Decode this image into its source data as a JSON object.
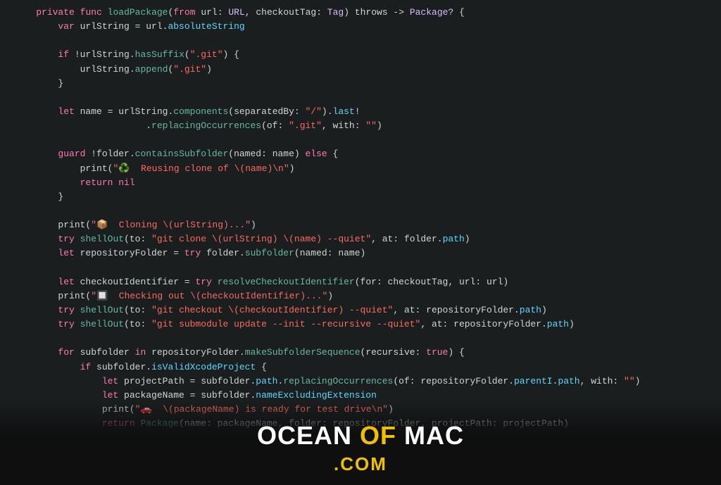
{
  "code": {
    "lines": [
      {
        "id": 1,
        "tokens": [
          {
            "t": "    ",
            "c": "plain"
          },
          {
            "t": "private",
            "c": "kw"
          },
          {
            "t": " ",
            "c": "plain"
          },
          {
            "t": "func",
            "c": "kw"
          },
          {
            "t": " ",
            "c": "plain"
          },
          {
            "t": "loadPackage",
            "c": "fn"
          },
          {
            "t": "(",
            "c": "plain"
          },
          {
            "t": "from",
            "c": "kw"
          },
          {
            "t": " url: ",
            "c": "plain"
          },
          {
            "t": "URL",
            "c": "type"
          },
          {
            "t": ", checkoutTag: ",
            "c": "plain"
          },
          {
            "t": "Tag",
            "c": "type"
          },
          {
            "t": ") throws -> ",
            "c": "plain"
          },
          {
            "t": "Package",
            "c": "type"
          },
          {
            "t": "? {",
            "c": "plain"
          }
        ]
      },
      {
        "id": 2,
        "tokens": [
          {
            "t": "        ",
            "c": "plain"
          },
          {
            "t": "var",
            "c": "kw"
          },
          {
            "t": " urlString = url.",
            "c": "plain"
          },
          {
            "t": "absoluteString",
            "c": "teal"
          }
        ]
      },
      {
        "id": 3,
        "tokens": []
      },
      {
        "id": 4,
        "tokens": [
          {
            "t": "        ",
            "c": "plain"
          },
          {
            "t": "if",
            "c": "kw"
          },
          {
            "t": " !urlString.",
            "c": "plain"
          },
          {
            "t": "hasSuffix",
            "c": "fn"
          },
          {
            "t": "(",
            "c": "plain"
          },
          {
            "t": "\".git\"",
            "c": "red"
          },
          {
            "t": ") {",
            "c": "plain"
          }
        ]
      },
      {
        "id": 5,
        "tokens": [
          {
            "t": "            urlString.",
            "c": "plain"
          },
          {
            "t": "append",
            "c": "fn"
          },
          {
            "t": "(",
            "c": "plain"
          },
          {
            "t": "\".git\"",
            "c": "red"
          },
          {
            "t": ")",
            "c": "plain"
          }
        ]
      },
      {
        "id": 6,
        "tokens": [
          {
            "t": "        }",
            "c": "plain"
          }
        ]
      },
      {
        "id": 7,
        "tokens": []
      },
      {
        "id": 8,
        "tokens": [
          {
            "t": "        ",
            "c": "plain"
          },
          {
            "t": "let",
            "c": "kw"
          },
          {
            "t": " name = urlString.",
            "c": "plain"
          },
          {
            "t": "components",
            "c": "fn"
          },
          {
            "t": "(separatedBy: ",
            "c": "plain"
          },
          {
            "t": "\"/\"",
            "c": "red"
          },
          {
            "t": ").",
            "c": "plain"
          },
          {
            "t": "last",
            "c": "teal"
          },
          {
            "t": "!",
            "c": "plain"
          }
        ]
      },
      {
        "id": 9,
        "tokens": [
          {
            "t": "                        .",
            "c": "plain"
          },
          {
            "t": "replacingOccurrences",
            "c": "fn"
          },
          {
            "t": "(of: ",
            "c": "plain"
          },
          {
            "t": "\".git\"",
            "c": "red"
          },
          {
            "t": ", with: ",
            "c": "plain"
          },
          {
            "t": "\"\"",
            "c": "red"
          },
          {
            "t": ")",
            "c": "plain"
          }
        ]
      },
      {
        "id": 10,
        "tokens": []
      },
      {
        "id": 11,
        "tokens": [
          {
            "t": "        ",
            "c": "plain"
          },
          {
            "t": "guard",
            "c": "kw"
          },
          {
            "t": " !folder.",
            "c": "plain"
          },
          {
            "t": "containsSubfolder",
            "c": "fn"
          },
          {
            "t": "(named: name) ",
            "c": "plain"
          },
          {
            "t": "else",
            "c": "kw"
          },
          {
            "t": " {",
            "c": "plain"
          }
        ]
      },
      {
        "id": 12,
        "tokens": [
          {
            "t": "            print(",
            "c": "plain"
          },
          {
            "t": "\"♻️  Reusing clone of \\(name)\\n\"",
            "c": "red"
          },
          {
            "t": ")",
            "c": "plain"
          }
        ]
      },
      {
        "id": 13,
        "tokens": [
          {
            "t": "            ",
            "c": "plain"
          },
          {
            "t": "return",
            "c": "kw"
          },
          {
            "t": " ",
            "c": "plain"
          },
          {
            "t": "nil",
            "c": "kw"
          }
        ]
      },
      {
        "id": 14,
        "tokens": [
          {
            "t": "        }",
            "c": "plain"
          }
        ]
      },
      {
        "id": 15,
        "tokens": []
      },
      {
        "id": 16,
        "tokens": [
          {
            "t": "        print(",
            "c": "plain"
          },
          {
            "t": "\"📦  Cloning \\(urlString)...\"",
            "c": "red"
          },
          {
            "t": ")",
            "c": "plain"
          }
        ]
      },
      {
        "id": 17,
        "tokens": [
          {
            "t": "        ",
            "c": "plain"
          },
          {
            "t": "try",
            "c": "kw"
          },
          {
            "t": " ",
            "c": "plain"
          },
          {
            "t": "shellOut",
            "c": "fn"
          },
          {
            "t": "(to: ",
            "c": "plain"
          },
          {
            "t": "\"git clone \\(urlString) \\(name) --quiet\"",
            "c": "red"
          },
          {
            "t": ", at: folder.",
            "c": "plain"
          },
          {
            "t": "path",
            "c": "teal"
          },
          {
            "t": ")",
            "c": "plain"
          }
        ]
      },
      {
        "id": 18,
        "tokens": [
          {
            "t": "        ",
            "c": "plain"
          },
          {
            "t": "let",
            "c": "kw"
          },
          {
            "t": " repositoryFolder = ",
            "c": "plain"
          },
          {
            "t": "try",
            "c": "kw"
          },
          {
            "t": " folder.",
            "c": "plain"
          },
          {
            "t": "subfolder",
            "c": "fn"
          },
          {
            "t": "(named: name)",
            "c": "plain"
          }
        ]
      },
      {
        "id": 19,
        "tokens": []
      },
      {
        "id": 20,
        "tokens": [
          {
            "t": "        ",
            "c": "plain"
          },
          {
            "t": "let",
            "c": "kw"
          },
          {
            "t": " checkoutIdentifier = ",
            "c": "plain"
          },
          {
            "t": "try",
            "c": "kw"
          },
          {
            "t": " ",
            "c": "plain"
          },
          {
            "t": "resolveCheckoutIdentifier",
            "c": "fn"
          },
          {
            "t": "(for: checkoutTag, url: url)",
            "c": "plain"
          }
        ]
      },
      {
        "id": 21,
        "tokens": [
          {
            "t": "        print(",
            "c": "plain"
          },
          {
            "t": "\"🔲  Checking out \\(checkoutIdentifier)...\"",
            "c": "red"
          },
          {
            "t": ")",
            "c": "plain"
          }
        ]
      },
      {
        "id": 22,
        "tokens": [
          {
            "t": "        ",
            "c": "plain"
          },
          {
            "t": "try",
            "c": "kw"
          },
          {
            "t": " ",
            "c": "plain"
          },
          {
            "t": "shellOut",
            "c": "fn"
          },
          {
            "t": "(to: ",
            "c": "plain"
          },
          {
            "t": "\"git checkout \\(checkoutIdentifier) --quiet\"",
            "c": "red"
          },
          {
            "t": ", at: repositoryFolder.",
            "c": "plain"
          },
          {
            "t": "path",
            "c": "teal"
          },
          {
            "t": ")",
            "c": "plain"
          }
        ]
      },
      {
        "id": 23,
        "tokens": [
          {
            "t": "        ",
            "c": "plain"
          },
          {
            "t": "try",
            "c": "kw"
          },
          {
            "t": " ",
            "c": "plain"
          },
          {
            "t": "shellOut",
            "c": "fn"
          },
          {
            "t": "(to: ",
            "c": "plain"
          },
          {
            "t": "\"git submodule update --init --recursive --quiet\"",
            "c": "red"
          },
          {
            "t": ", at: repositoryFolder.",
            "c": "plain"
          },
          {
            "t": "path",
            "c": "teal"
          },
          {
            "t": ")",
            "c": "plain"
          }
        ]
      },
      {
        "id": 24,
        "tokens": []
      },
      {
        "id": 25,
        "tokens": [
          {
            "t": "        ",
            "c": "plain"
          },
          {
            "t": "for",
            "c": "kw"
          },
          {
            "t": " subfolder ",
            "c": "plain"
          },
          {
            "t": "in",
            "c": "kw"
          },
          {
            "t": " repositoryFolder.",
            "c": "plain"
          },
          {
            "t": "makeSubfolderSequence",
            "c": "fn"
          },
          {
            "t": "(recursive: ",
            "c": "plain"
          },
          {
            "t": "true",
            "c": "kw"
          },
          {
            "t": ") {",
            "c": "plain"
          }
        ]
      },
      {
        "id": 26,
        "tokens": [
          {
            "t": "            ",
            "c": "plain"
          },
          {
            "t": "if",
            "c": "kw"
          },
          {
            "t": " subfolder.",
            "c": "plain"
          },
          {
            "t": "isValidXcodeProject",
            "c": "teal"
          },
          {
            "t": " {",
            "c": "plain"
          }
        ]
      },
      {
        "id": 27,
        "tokens": [
          {
            "t": "                ",
            "c": "plain"
          },
          {
            "t": "let",
            "c": "kw"
          },
          {
            "t": " projectPath = subfolder.",
            "c": "plain"
          },
          {
            "t": "path",
            "c": "teal"
          },
          {
            "t": ".",
            "c": "plain"
          },
          {
            "t": "replacingOccurrences",
            "c": "fn"
          },
          {
            "t": "(of: repositoryFolder.",
            "c": "plain"
          },
          {
            "t": "parentI",
            "c": "teal"
          },
          {
            "t": ".",
            "c": "plain"
          },
          {
            "t": "path",
            "c": "teal"
          },
          {
            "t": ", with: ",
            "c": "plain"
          },
          {
            "t": "\"\"",
            "c": "red"
          },
          {
            "t": ")",
            "c": "plain"
          }
        ]
      },
      {
        "id": 28,
        "tokens": [
          {
            "t": "                ",
            "c": "plain"
          },
          {
            "t": "let",
            "c": "kw"
          },
          {
            "t": " packageName = subfolder.",
            "c": "plain"
          },
          {
            "t": "nameExcludingExtension",
            "c": "teal"
          }
        ]
      },
      {
        "id": 29,
        "tokens": [
          {
            "t": "                print(",
            "c": "plain"
          },
          {
            "t": "\"🚗  \\(packageName) is ready for test drive\\n\"",
            "c": "red"
          },
          {
            "t": ")",
            "c": "plain"
          }
        ]
      },
      {
        "id": 30,
        "tokens": [
          {
            "t": "                ",
            "c": "plain"
          },
          {
            "t": "return",
            "c": "kw"
          },
          {
            "t": " ",
            "c": "plain"
          },
          {
            "t": "Package",
            "c": "fn"
          },
          {
            "t": "(name: packageName, folder: repositoryFolder, projectPath: projectPath)",
            "c": "plain"
          }
        ]
      }
    ]
  },
  "watermark": {
    "ocean": "OCEAN",
    "of": "OF",
    "mac": "MAC",
    "com": ".COM"
  }
}
